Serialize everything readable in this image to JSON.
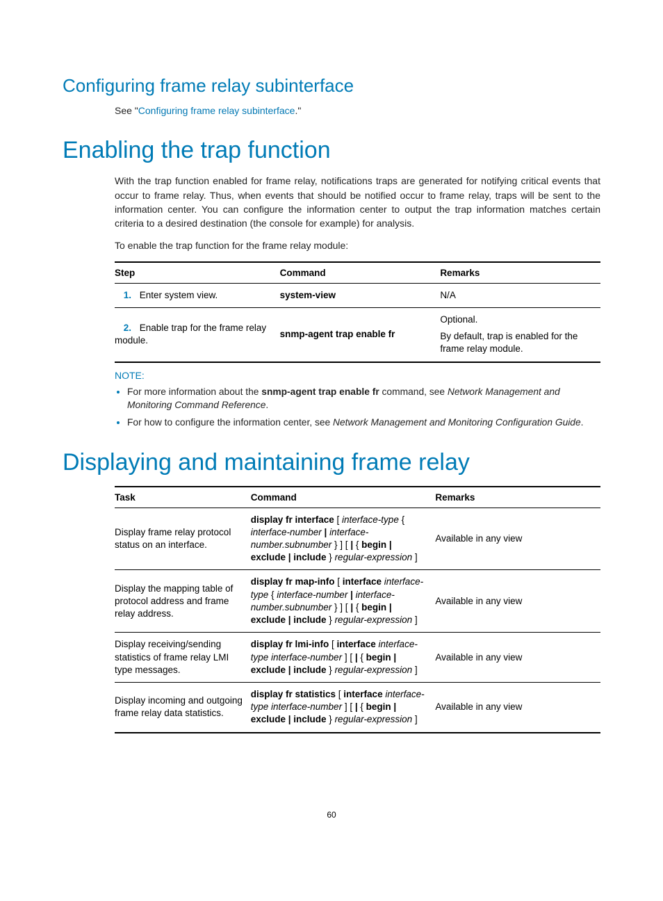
{
  "section_subinterface": {
    "heading": "Configuring frame relay subinterface",
    "see_prefix": "See \"",
    "see_link": "Configuring frame relay subinterface",
    "see_suffix": ".\""
  },
  "section_trap": {
    "heading": "Enabling the trap function",
    "para1": "With the trap function enabled for frame relay, notifications traps are generated for notifying critical events that occur to frame relay. Thus, when events that should be notified occur to frame relay, traps will be sent to the information center. You can configure the information center to output the trap information matches certain criteria to a desired destination (the console for example) for analysis.",
    "para2": "To enable the trap function for the frame relay module:",
    "table_head": {
      "c1": "Step",
      "c2": "Command",
      "c3": "Remarks"
    },
    "rows": [
      {
        "num": "1.",
        "step": "Enter system view.",
        "cmd": "system-view",
        "rem": "N/A"
      },
      {
        "num": "2.",
        "step": "Enable trap for the frame relay module.",
        "cmd": "snmp-agent trap enable fr",
        "rem1": "Optional.",
        "rem2": "By default, trap is enabled for the frame relay module."
      }
    ],
    "note_label": "NOTE:",
    "notes": {
      "n1_a": "For more information about the ",
      "n1_b": "snmp-agent trap enable fr",
      "n1_c": " command, see ",
      "n1_d": "Network Management and Monitoring Command Reference",
      "n1_e": ".",
      "n2_a": "For how to configure the information center, see ",
      "n2_b": "Network Management and Monitoring Configuration Guide",
      "n2_c": "."
    }
  },
  "section_display": {
    "heading": "Displaying and maintaining frame relay",
    "table_head": {
      "c1": "Task",
      "c2": "Command",
      "c3": "Remarks"
    },
    "rows": {
      "r1": {
        "task": "Display frame relay protocol status on an interface.",
        "cmd_parts": [
          "display fr interface",
          " [ ",
          "interface-type",
          " { ",
          "interface-number",
          " | ",
          "interface-number.subnumber",
          " } ] [ ",
          "|",
          " { ",
          "begin",
          " | ",
          "exclude",
          " | ",
          "include",
          " } ",
          "regular-expression",
          " ]"
        ],
        "rem": "Available in any view"
      },
      "r2": {
        "task": "Display the mapping table of protocol address and frame relay address.",
        "cmd_parts": [
          "display fr map-info",
          " [ ",
          "interface",
          " ",
          "interface-type",
          " { ",
          "interface-number",
          " | ",
          "interface-number.subnumber",
          " } ] [ ",
          "|",
          " { ",
          "begin",
          " | ",
          "exclude",
          " | ",
          "include",
          " } ",
          "regular-expression",
          " ]"
        ],
        "rem": "Available in any view"
      },
      "r3": {
        "task": "Display receiving/sending statistics of frame relay LMI type messages.",
        "cmd_parts": [
          "display fr lmi-info",
          " [ ",
          "interface",
          " ",
          "interface-type",
          " ",
          "interface-number",
          " ] [ ",
          "|",
          " { ",
          "begin",
          " | ",
          "exclude",
          " | ",
          "include",
          " } ",
          "regular-expression",
          " ]"
        ],
        "rem": "Available in any view"
      },
      "r4": {
        "task": "Display incoming and outgoing frame relay data statistics.",
        "cmd_parts": [
          "display fr statistics",
          " [ ",
          "interface",
          " ",
          "interface-type",
          " ",
          "interface-number",
          " ] [ ",
          "|",
          " { ",
          "begin",
          " | ",
          "exclude",
          " | ",
          "include",
          " } ",
          "regular-expression",
          " ]"
        ],
        "rem": "Available in any view"
      }
    }
  },
  "page_number": "60"
}
